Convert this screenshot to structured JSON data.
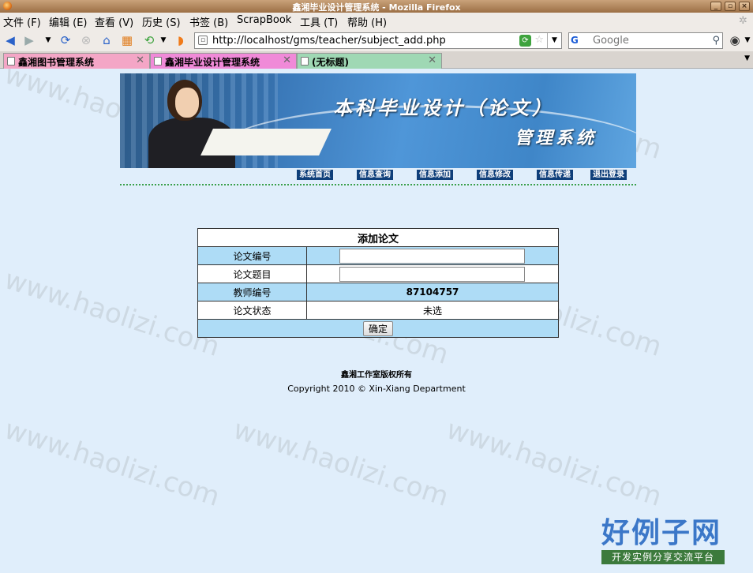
{
  "window": {
    "title": "鑫湘毕业设计管理系统 - Mozilla Firefox"
  },
  "menu": [
    "文件 (F)",
    "编辑 (E)",
    "查看 (V)",
    "历史 (S)",
    "书签 (B)",
    "ScrapBook",
    "工具 (T)",
    "帮助 (H)"
  ],
  "navigation": {
    "url": "http://localhost/gms/teacher/subject_add.php",
    "search_placeholder": "Google",
    "search_engine": "G"
  },
  "tabs": [
    {
      "label": "鑫湘图书管理系统",
      "color": "#f4a6c6"
    },
    {
      "label": "鑫湘毕业设计管理系统",
      "color": "#f08ad8"
    },
    {
      "label": "(无标题)",
      "color": "#9fd8b4"
    }
  ],
  "banner": {
    "title_line1": "本科毕业设计（论文）",
    "title_line2": "管理系统"
  },
  "site_nav": [
    "系统首页",
    "信息查询",
    "信息添加",
    "信息修改",
    "信息传递",
    "退出登录"
  ],
  "form": {
    "caption": "添加论文",
    "rows": [
      {
        "label": "论文编号",
        "type": "input",
        "value": ""
      },
      {
        "label": "论文题目",
        "type": "input",
        "value": ""
      },
      {
        "label": "教师编号",
        "type": "text",
        "value": "87104757"
      },
      {
        "label": "论文状态",
        "type": "text",
        "value": "未选"
      }
    ],
    "submit": "确定"
  },
  "footer": {
    "line1": "鑫湘工作室版权所有",
    "line2": "Copyright 2010 © Xin-Xiang Department"
  },
  "watermark": "www.haolizi.com",
  "logo": {
    "big": "好例子网",
    "small": "开发实例分享交流平台"
  }
}
